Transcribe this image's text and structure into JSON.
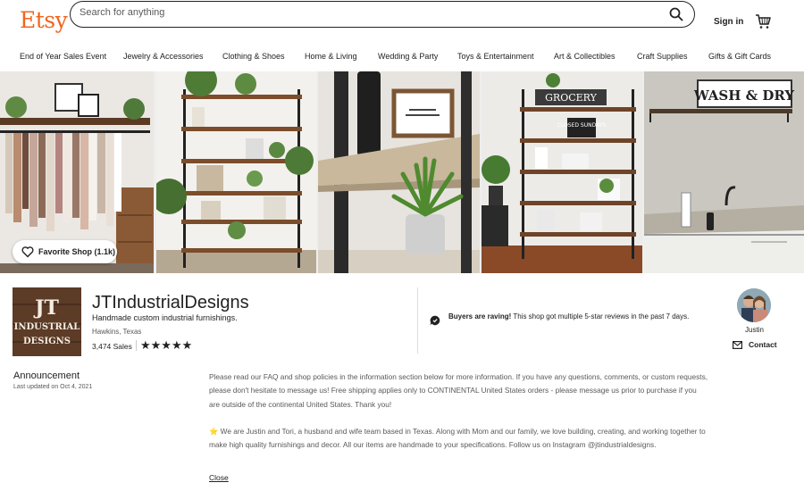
{
  "header": {
    "logo": "Etsy",
    "search_placeholder": "Search for anything",
    "signin_label": "Sign in"
  },
  "categories": [
    "End of Year Sales Event",
    "Jewelry & Accessories",
    "Clothing & Shoes",
    "Home & Living",
    "Wedding & Party",
    "Toys & Entertainment",
    "Art & Collectibles",
    "Craft Supplies",
    "Gifts & Gift Cards"
  ],
  "banner": {
    "favorite_label": "Favorite Shop (1.1k)",
    "sign_text_grocery": "GROCERY",
    "sign_text_closed": "CLOSED SUNDAYS",
    "sign_text_wash": "WASH & DRY"
  },
  "shop": {
    "logo_text_1": "JT",
    "logo_text_2": "INDUSTRIAL",
    "logo_text_3": "DESIGNS",
    "name": "JTIndustrialDesigns",
    "tagline": "Handmade custom industrial furnishings.",
    "location": "Hawkins, Texas",
    "sales": "3,474 Sales",
    "rating": 5,
    "stars": "★★★★★"
  },
  "rave": {
    "bold": "Buyers are raving!",
    "text": " This shop got multiple 5-star reviews in the past 7 days."
  },
  "owner": {
    "name": "Justin",
    "contact_label": "Contact"
  },
  "announcement": {
    "title": "Announcement",
    "date": "Last updated on Oct 4, 2021",
    "paragraph_1": "Please read our FAQ and shop policies in the information section below for more information. If you have any questions, comments, or custom requests, please don't hesitate to message us! Free shipping applies only to CONTINENTAL United States orders - please message us prior to purchase if you are outside of the continental United States. Thank you!",
    "paragraph_2": "⭐ We are Justin and Tori, a husband and wife team based in Texas. Along with Mom and our family, we love building, creating, and working together to make high quality furnishings and decor. All our items are handmade to your specifications. Follow us on Instagram @jtindustrialdesigns.",
    "close_label": "Close"
  },
  "colors": {
    "brand": "#F1641E",
    "text": "#222222",
    "muted": "#595959"
  }
}
